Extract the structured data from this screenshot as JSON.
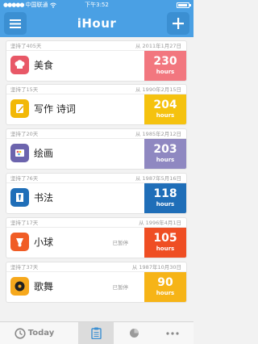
{
  "status_bar": {
    "carrier": "中国联通",
    "time": "下午3:52"
  },
  "app": {
    "title": "iHour"
  },
  "colors": {
    "header": "#4aa0e4",
    "accent": "#3b8fd2"
  },
  "cards": [
    {
      "persist": "坚持了405天",
      "since": "从 2011年1月27日",
      "name": "美食",
      "hours": "230",
      "unit": "hours",
      "color": "#f2777f",
      "badge_color": "#e85867",
      "icon": "chef-hat-icon",
      "paused": ""
    },
    {
      "persist": "坚持了15天",
      "since": "从 1990年2月15日",
      "name": "写作 诗词",
      "hours": "204",
      "unit": "hours",
      "color": "#f5c20f",
      "badge_color": "#f2b807",
      "icon": "pencil-icon",
      "paused": ""
    },
    {
      "persist": "坚持了20天",
      "since": "从 1985年2月12日",
      "name": "绘画",
      "hours": "203",
      "unit": "hours",
      "color": "#8f88c1",
      "badge_color": "#6c64ad",
      "icon": "palette-icon",
      "paused": ""
    },
    {
      "persist": "坚持了76天",
      "since": "从 1987年5月16日",
      "name": "书法",
      "hours": "118",
      "unit": "hours",
      "color": "#1f6eb8",
      "badge_color": "#1f6eb8",
      "icon": "brush-icon",
      "paused": ""
    },
    {
      "persist": "坚持了17天",
      "since": "从 1996年4月1日",
      "name": "小球",
      "hours": "105",
      "unit": "hours",
      "color": "#ef4e23",
      "badge_color": "#f05c25",
      "icon": "shuttlecock-icon",
      "paused": "已暂停"
    },
    {
      "persist": "坚持了37天",
      "since": "从 1987年10月30日",
      "name": "歌舞",
      "hours": "90",
      "unit": "hours",
      "color": "#f6b417",
      "badge_color": "#f6a81c",
      "icon": "music-icon",
      "paused": "已暂停"
    }
  ],
  "tabbar": {
    "today_label": "Today"
  }
}
